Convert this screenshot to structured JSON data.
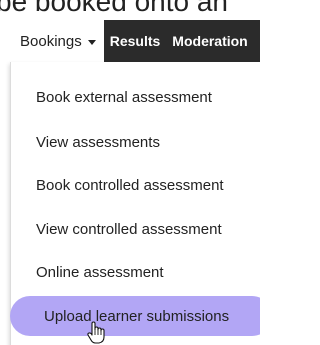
{
  "background": {
    "heading_fragment": "be booked onto an"
  },
  "navbar": {
    "items": [
      {
        "label": "Bookings"
      },
      {
        "label": "Results"
      },
      {
        "label": "Moderation"
      }
    ]
  },
  "dropdown": {
    "items": [
      {
        "label": "Book external assessment"
      },
      {
        "label": "View assessments"
      },
      {
        "label": "Book controlled assessment"
      },
      {
        "label": "View controlled assessment"
      },
      {
        "label": "Online assessment"
      },
      {
        "label": "Upload learner submissions"
      }
    ],
    "highlighted_index": 5,
    "highlight_color": "#b2a6f5"
  },
  "colors": {
    "navbar_bg": "#2b2b2b",
    "navbar_text": "#ffffff"
  },
  "cursor": {
    "icon": "hand-pointer-icon"
  }
}
